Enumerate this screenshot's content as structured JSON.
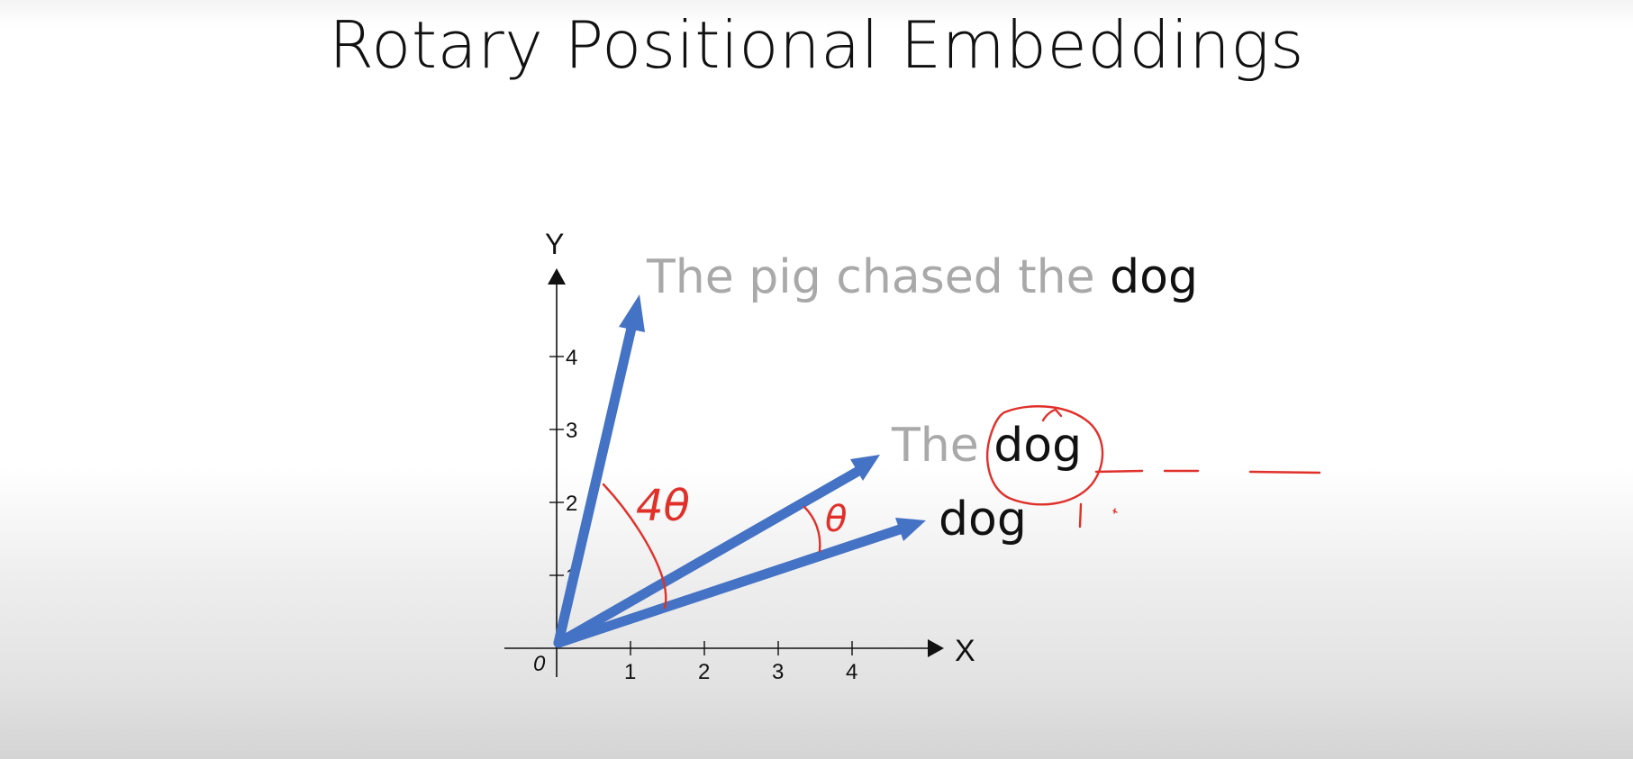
{
  "slide": {
    "title": "Rotary Positional Embeddings"
  },
  "diagram": {
    "axes": {
      "x_label": "X",
      "y_label": "Y",
      "origin_label": "0",
      "x_ticks": [
        "1",
        "2",
        "3",
        "4"
      ],
      "y_ticks": [
        "1",
        "2",
        "3",
        "4"
      ]
    },
    "vectors": [
      {
        "name": "long-sentence-vector",
        "prefix": "The pig chased the ",
        "word": "dog"
      },
      {
        "name": "short-sentence-vector",
        "prefix": "The ",
        "word": "dog"
      },
      {
        "name": "single-word-vector",
        "prefix": "",
        "word": "dog"
      }
    ],
    "annotations": {
      "large_angle": "4θ",
      "small_angle": "θ",
      "position_mark": "1"
    },
    "colors": {
      "vector": "#4472c4",
      "annotation": "#e0302a",
      "muted_text": "#a9a9a9",
      "strong_text": "#111111"
    }
  }
}
